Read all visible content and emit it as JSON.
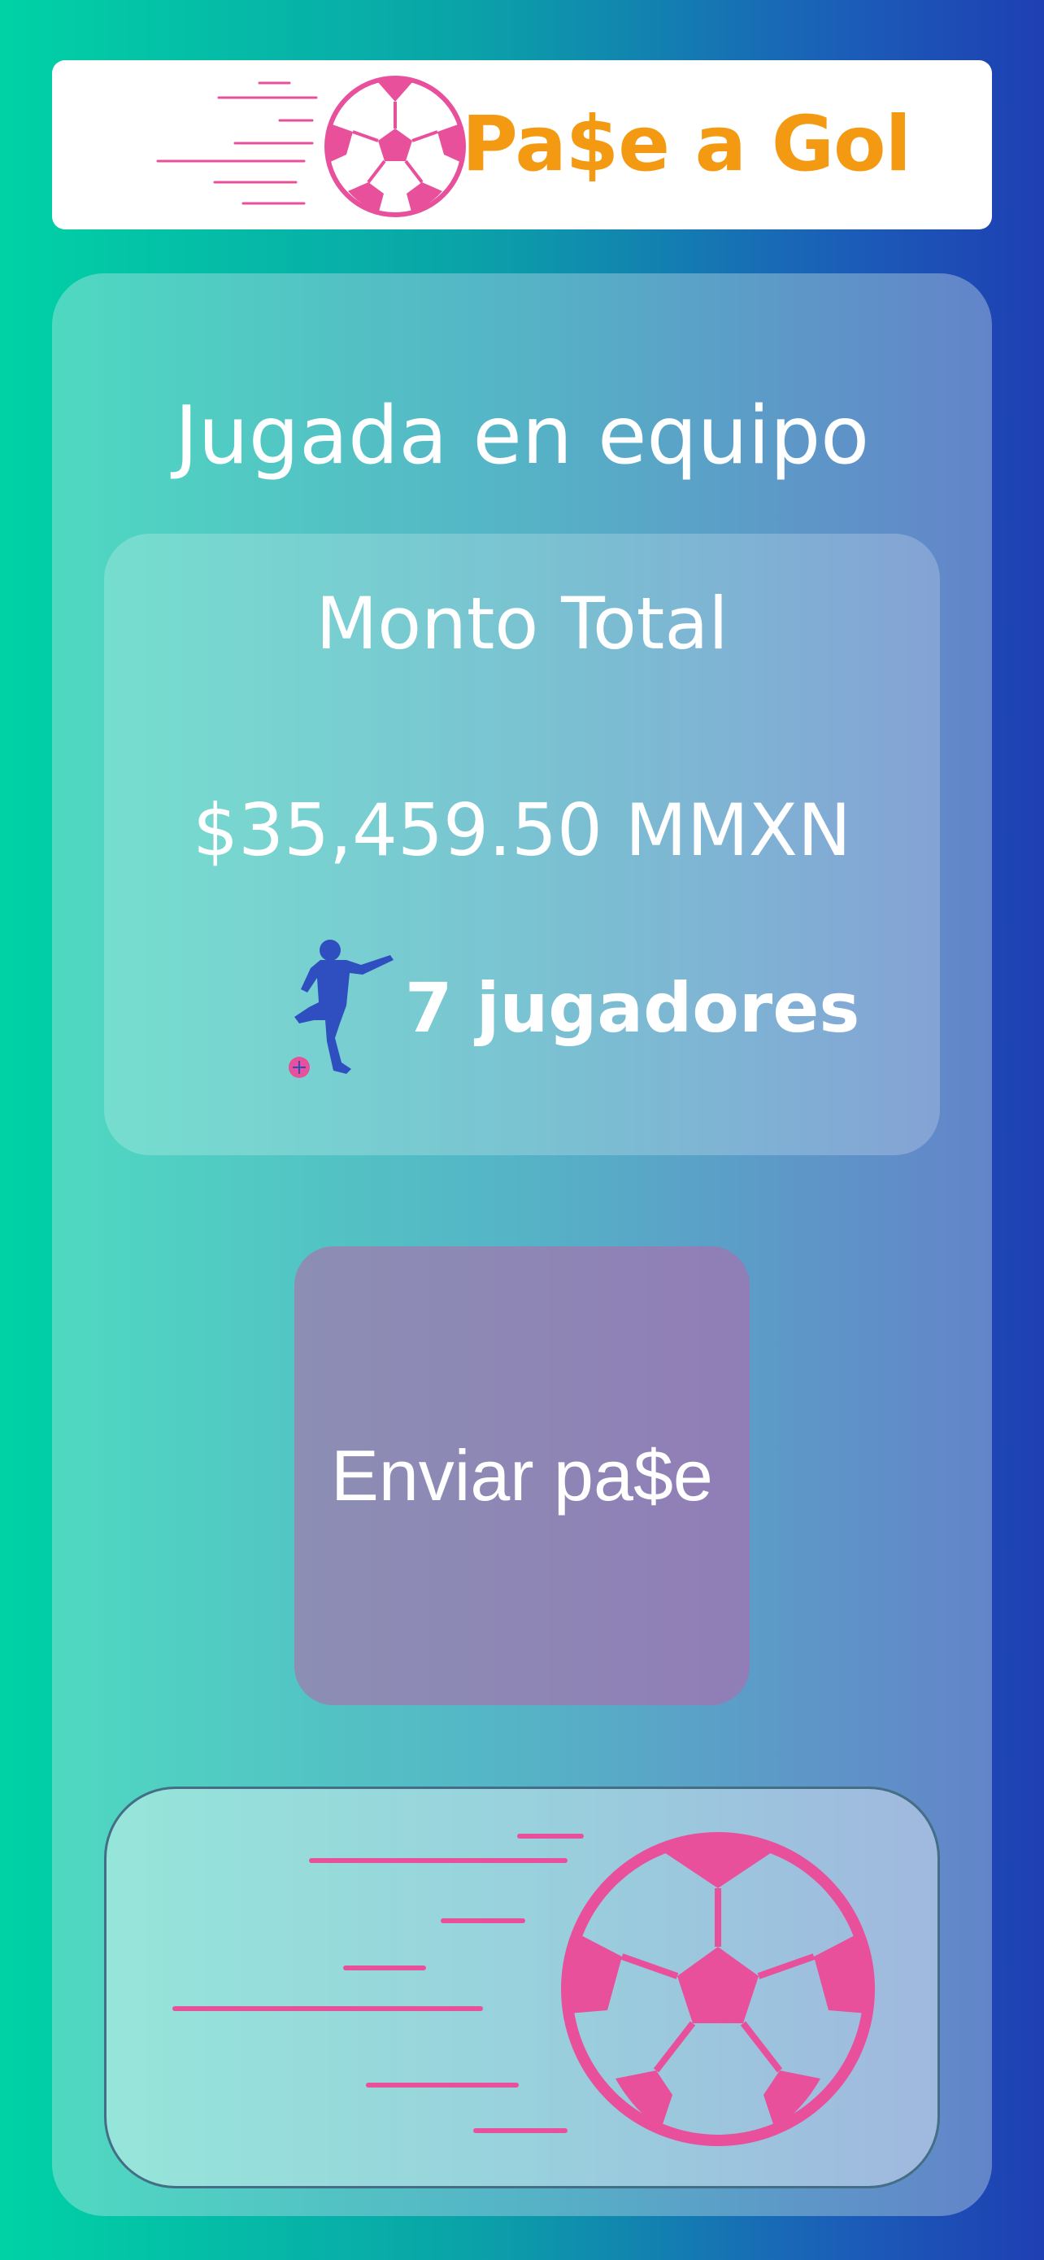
{
  "header": {
    "title": "Pa$e a Gol",
    "logo_icon": "speeding-soccer-ball-icon",
    "accent_color": "#f39a12",
    "logo_color": "#e8509c"
  },
  "main": {
    "title": "Jugada en equipo",
    "total": {
      "label": "Monto Total",
      "amount": "$35,459.50 MMXN"
    },
    "players": {
      "icon": "soccer-player-icon",
      "count_label": "7 jugadores"
    },
    "send_button": {
      "label": "Enviar pa$e"
    },
    "footer_icon": "speeding-soccer-ball-icon"
  }
}
